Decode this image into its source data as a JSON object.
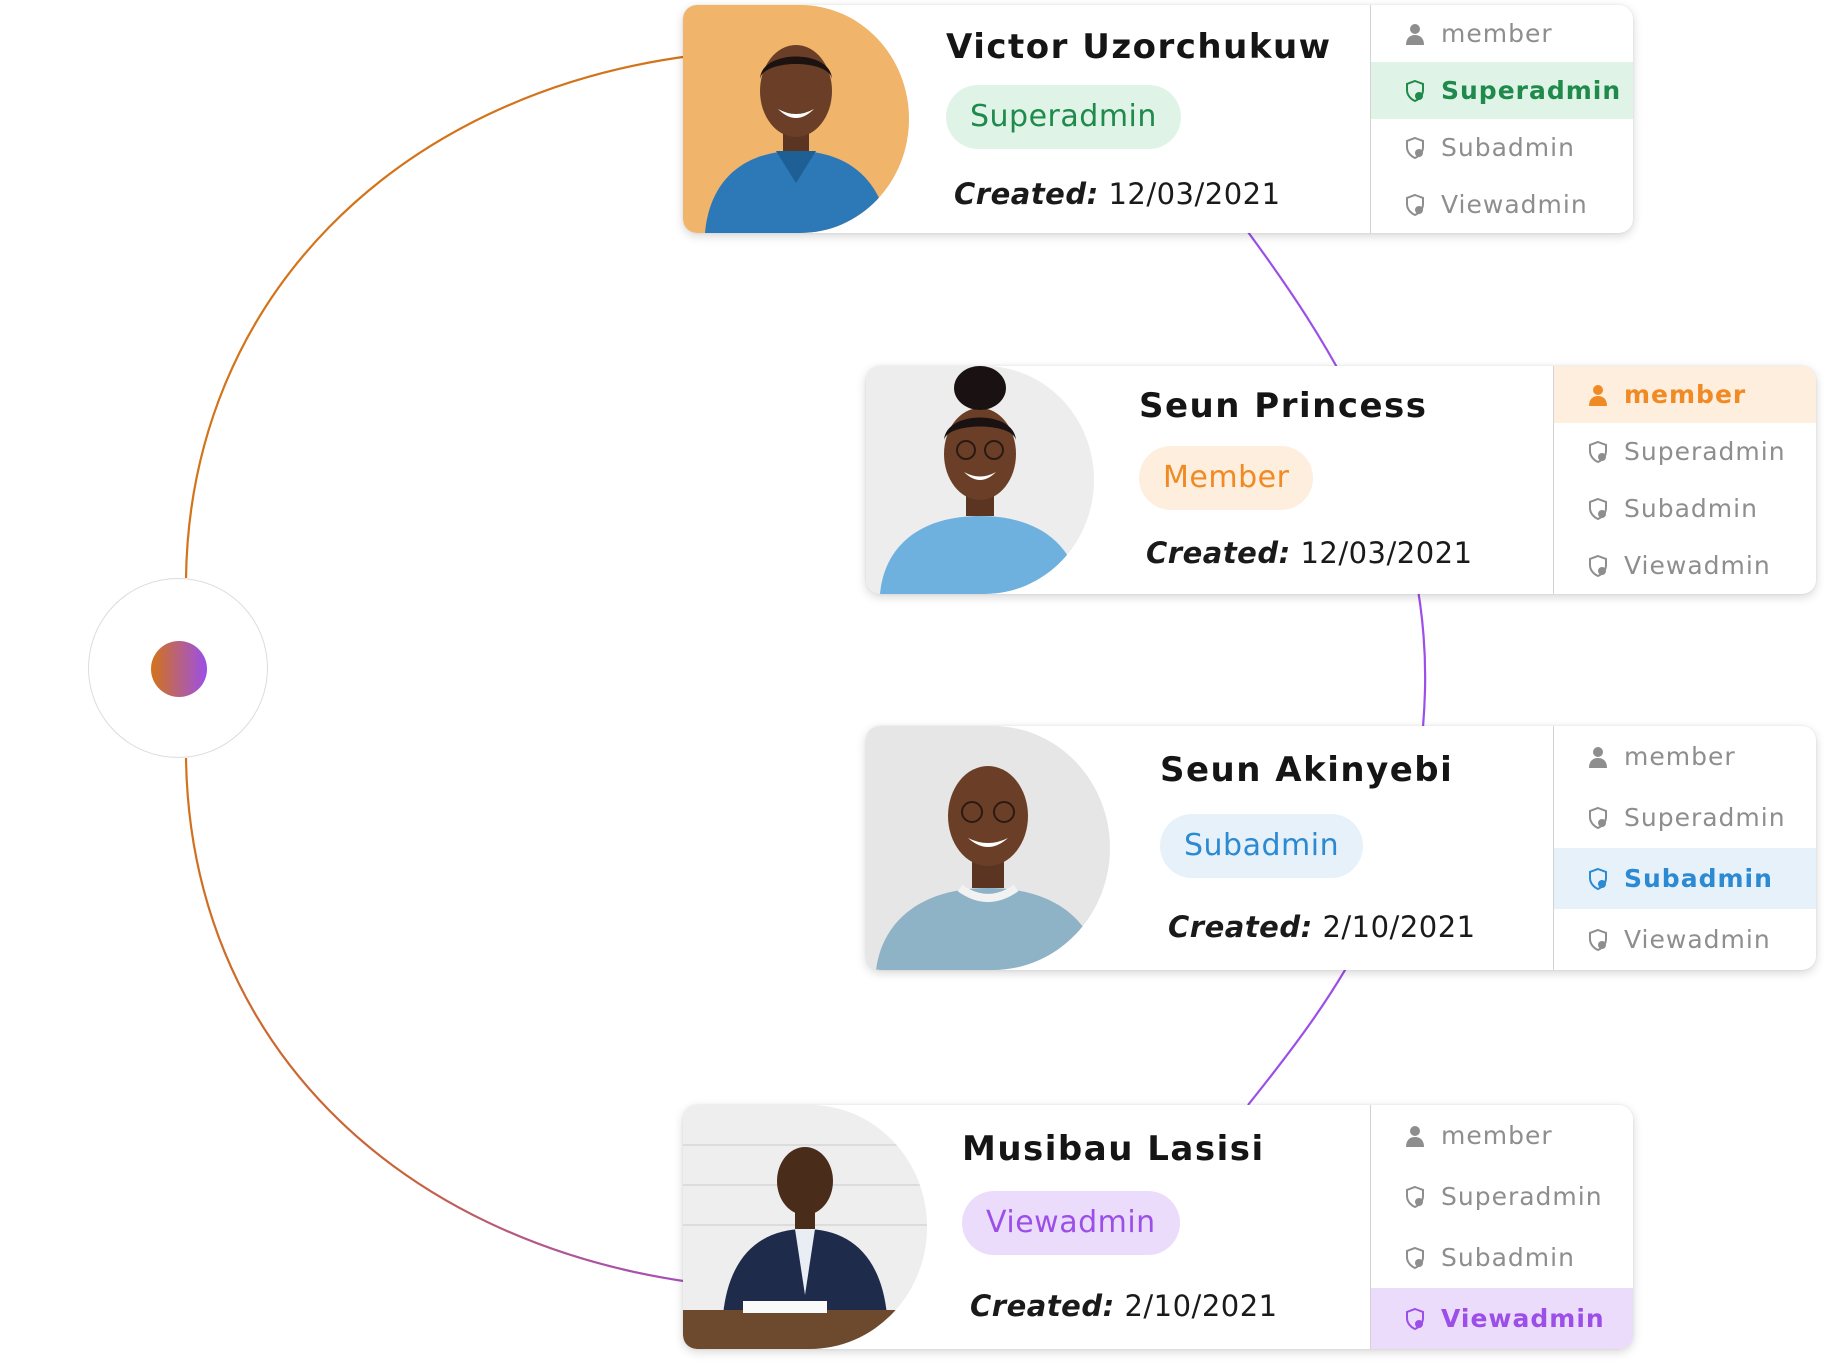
{
  "colors": {
    "ring_orange": "#d3731a",
    "ring_purple": "#9b4fe8",
    "superadmin": "#1f8a4c",
    "superadmin_bg": "#dff4e6",
    "member": "#f08a24",
    "member_bg": "#fdeedd",
    "subadmin": "#2c8ad2",
    "subadmin_bg": "#e6f1fa",
    "viewadmin": "#9b4fe8",
    "viewadmin_bg": "#ecdcfb",
    "muted_text": "#8e8e8e"
  },
  "menu_labels": [
    "member",
    "Superadmin",
    "Subadmin",
    "Viewadmin"
  ],
  "menu_icons": [
    "member-icon",
    "shield-icon",
    "shield-icon",
    "shield-icon"
  ],
  "created_label": "Created:",
  "users": [
    {
      "name": "Victor Uzorchukuw",
      "role": "Superadmin",
      "created_date": "12/03/2021",
      "selected_menu_index": 1,
      "accent": "#1f8a4c",
      "badge_bg": "#dff4e6",
      "photo_bg": "#f0b46a"
    },
    {
      "name": "Seun Princess",
      "role": "Member",
      "created_date": "12/03/2021",
      "selected_menu_index": 0,
      "accent": "#f08a24",
      "badge_bg": "#fdeedd",
      "photo_bg": "#ededed"
    },
    {
      "name": "Seun Akinyebi",
      "role": "Subadmin",
      "created_date": "2/10/2021",
      "selected_menu_index": 2,
      "accent": "#2c8ad2",
      "badge_bg": "#e6f1fa",
      "photo_bg": "#e6e6e6"
    },
    {
      "name": "Musibau Lasisi",
      "role": "Viewadmin",
      "created_date": "2/10/2021",
      "selected_menu_index": 3,
      "accent": "#9b4fe8",
      "badge_bg": "#ecdcfb",
      "photo_bg": "#f2f2f2"
    }
  ]
}
